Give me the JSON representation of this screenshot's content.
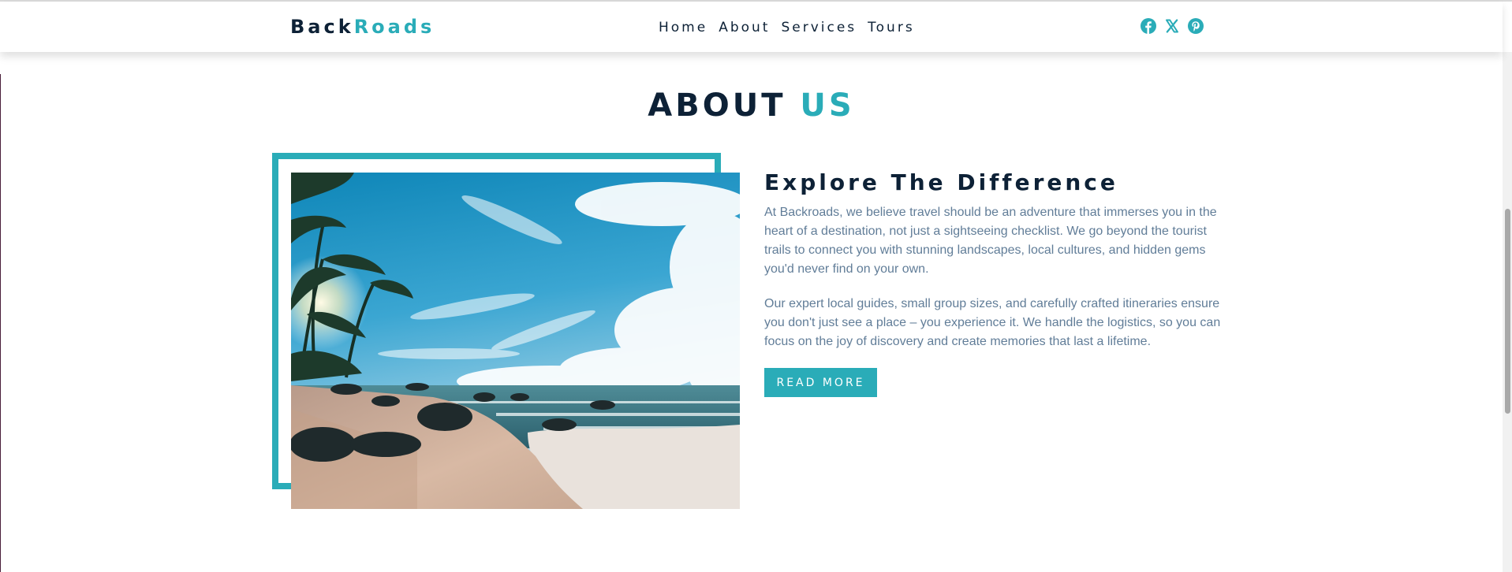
{
  "navbar": {
    "logo": {
      "part_a": "Back",
      "part_b": "Roads"
    },
    "links": [
      "Home",
      "About",
      "Services",
      "Tours"
    ],
    "social_icons": [
      "facebook-icon",
      "x-twitter-icon",
      "pinterest-icon"
    ]
  },
  "about": {
    "title": {
      "part_a": "ABOUT",
      "part_b": "US"
    },
    "heading": "Explore The Difference",
    "paragraphs": [
      "At Backroads, we believe travel should be an adventure that immerses you in the heart of a destination, not just a sightseeing checklist. We go beyond the tourist trails to connect you with stunning landscapes, local cultures, and hidden gems you'd never find on your own.",
      "Our expert local guides, small group sizes, and carefully crafted itineraries ensure you don't just see a place – you experience it. We handle the logistics, so you can focus on the joy of discovery and create memories that last a lifetime."
    ],
    "button_label": "READ MORE",
    "image_subject": "tropical-beach-photo"
  },
  "colors": {
    "primary": "#2aacb8",
    "dark": "#0d2136",
    "text_grey": "#617d98",
    "white": "#ffffff"
  }
}
